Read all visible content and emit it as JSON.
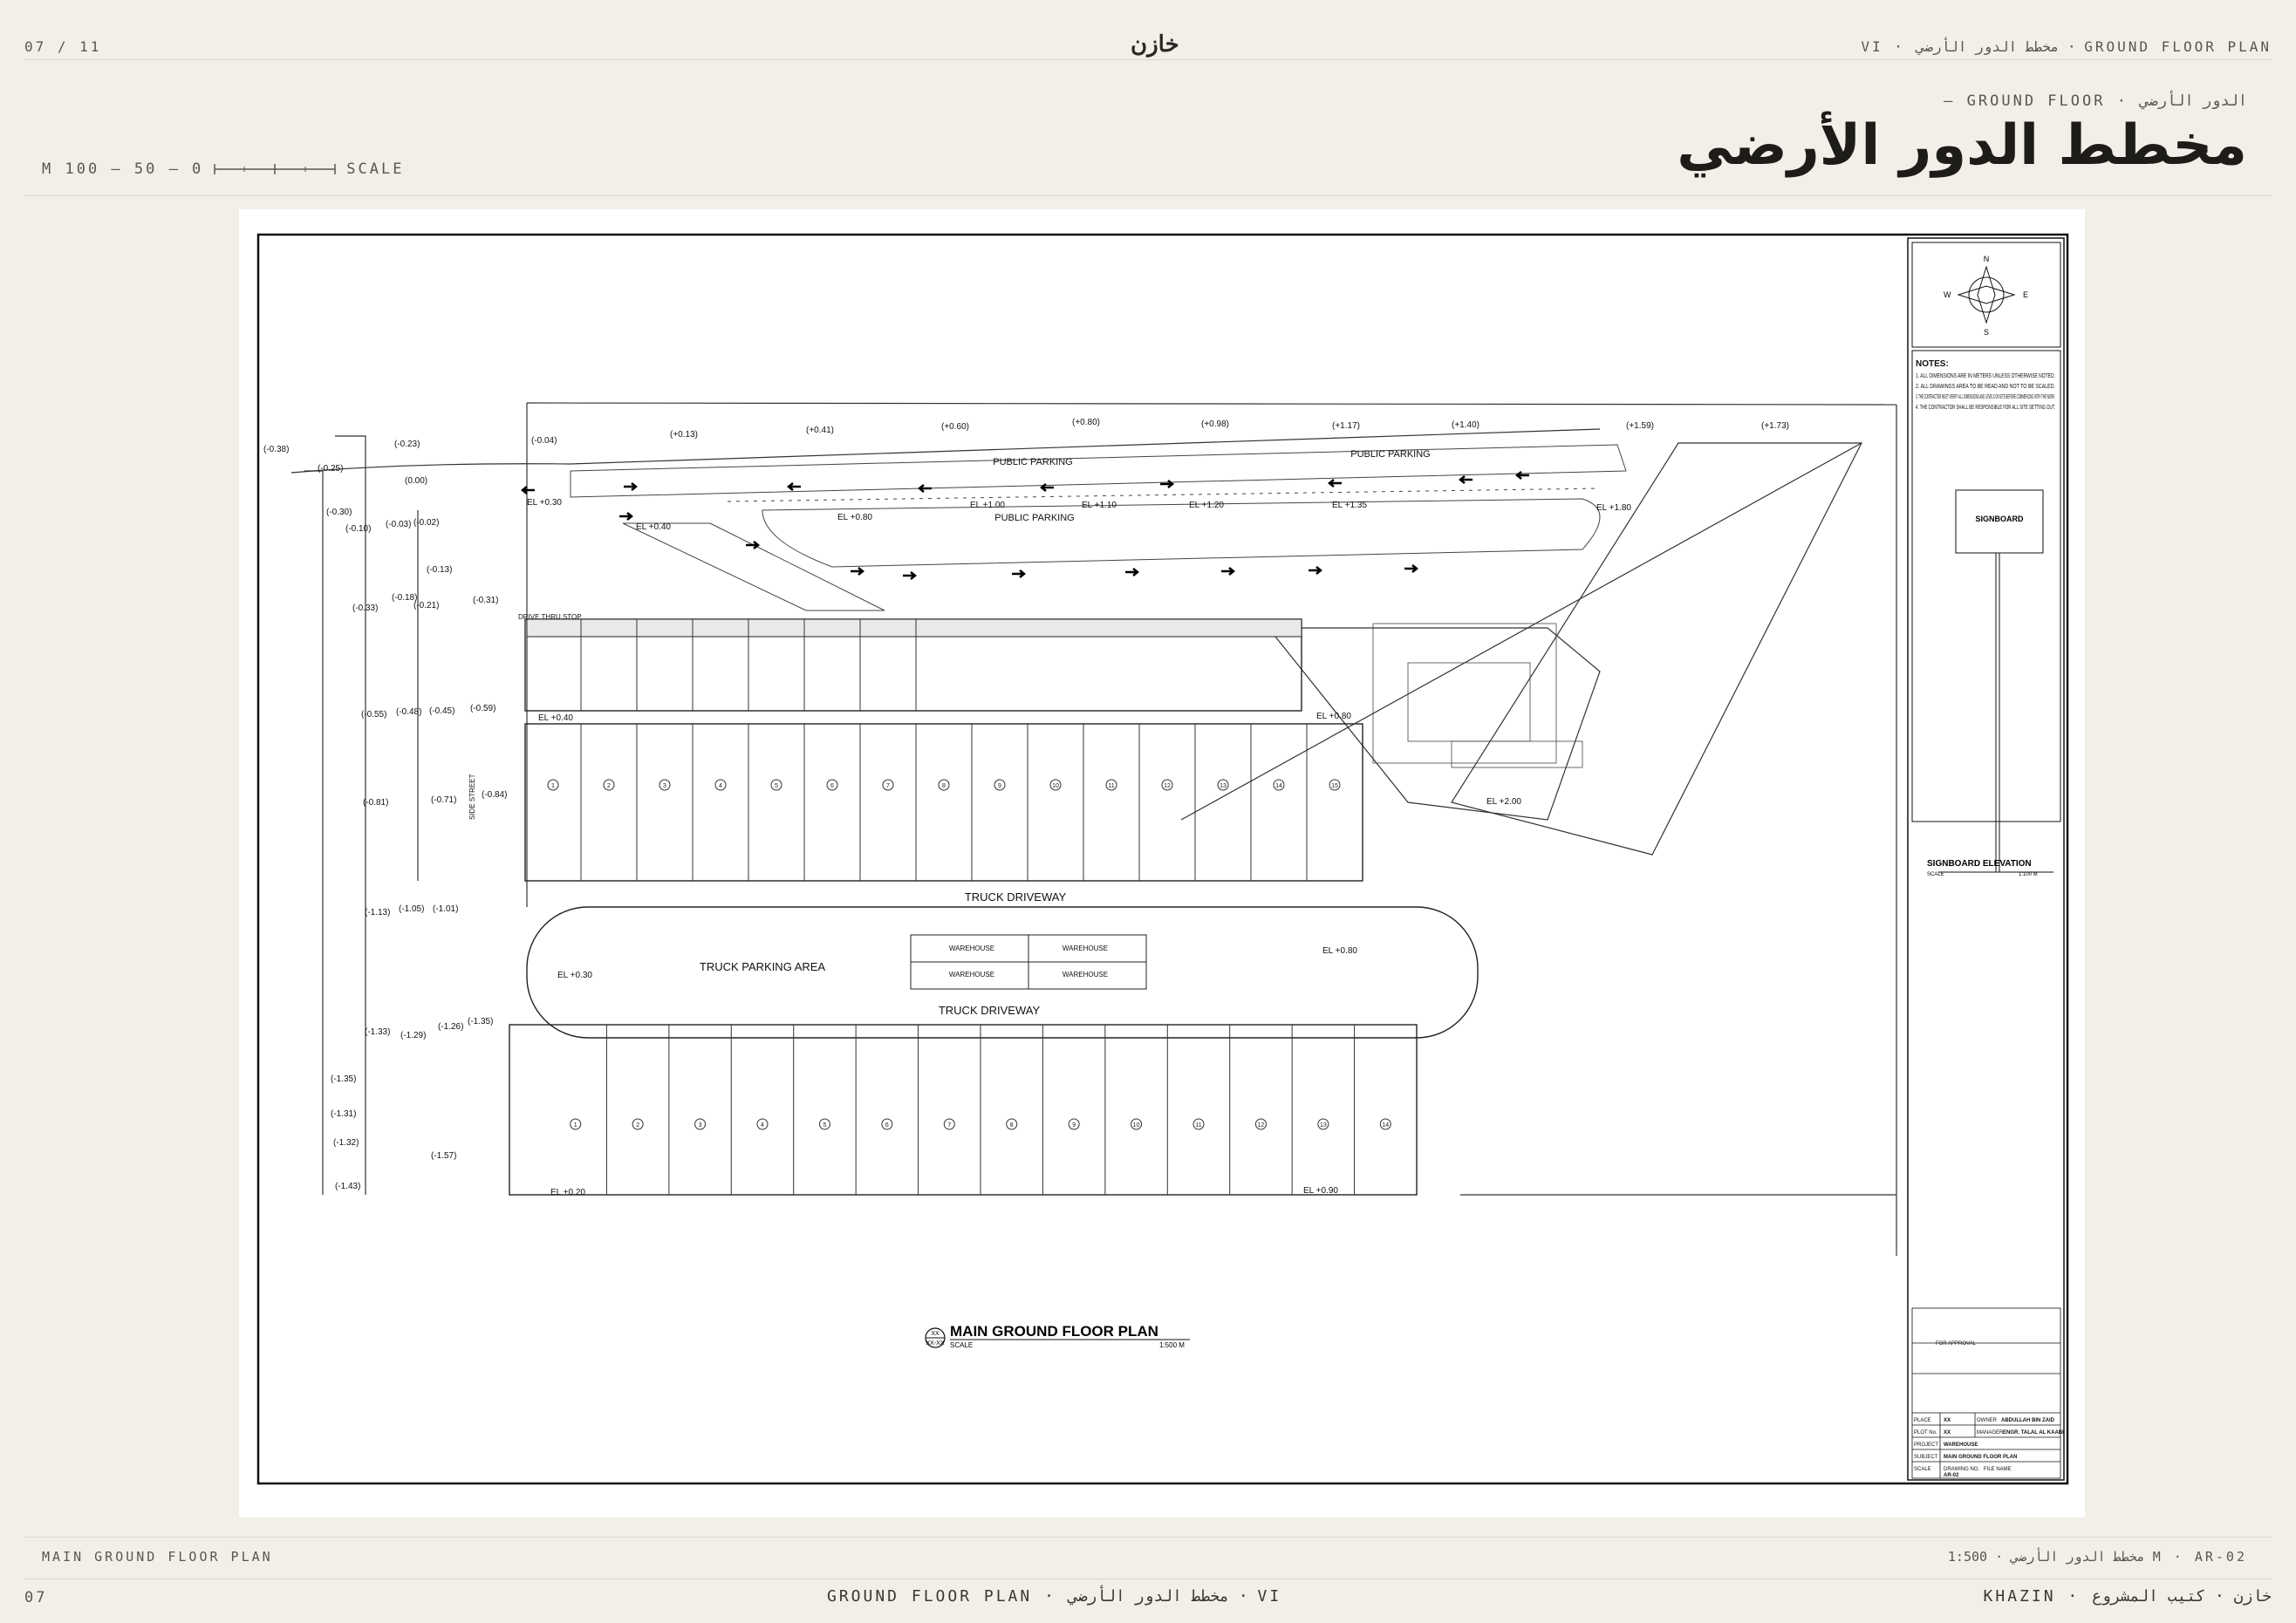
{
  "header": {
    "page_counter": "07 / 11",
    "logo_text": "خازن",
    "right_label": "VI · مخطط الدور الأرضي · GROUND FLOOR PLAN"
  },
  "title_block": {
    "eyebrow": "— GROUND FLOOR · الدور الأرضي",
    "title": "مخطط الدور الأرضي",
    "scale_label_left": "M 100 — 50 — 0",
    "scale_label_right": "SCALE"
  },
  "drawing": {
    "plan_title": "MAIN GROUND FLOOR PLAN",
    "plan_scale_label": "SCALE",
    "plan_scale_value": "1:500 M",
    "tag_top": "XX",
    "tag_bottom": "XX-XX",
    "labels": {
      "public_parking_1": "PUBLIC PARKING",
      "public_parking_2": "PUBLIC PARKING",
      "public_parking_3": "PUBLIC PARKING",
      "truck_driveway_1": "TRUCK DRIVEWAY",
      "truck_driveway_2": "TRUCK DRIVEWAY",
      "truck_parking": "TRUCK PARKING AREA",
      "drive_thru": "DRIVE THRU STOP",
      "side_street": "SIDE STREET",
      "warehouse": "WAREHOUSE"
    },
    "levels_top": [
      "(-0.38)",
      "(-0.23)",
      "(-0.04)",
      "(+0.13)",
      "(+0.41)",
      "(+0.60)",
      "(+0.80)",
      "(+0.98)",
      "(+1.17)",
      "(+1.40)",
      "(+1.59)",
      "(+1.73)"
    ],
    "levels_left": [
      "(-0.25)",
      "(0.00)",
      "(-0.30)",
      "(-0.10)",
      "(-0.03)",
      "(-0.02)",
      "(-0.13)",
      "(-0.18)",
      "(-0.33)",
      "(-0.21)",
      "(-0.31)",
      "(-0.55)",
      "(-0.48)",
      "(-0.45)",
      "(-0.59)",
      "(-0.81)",
      "(-0.71)",
      "(-0.84)",
      "(-1.13)",
      "(-1.05)",
      "(-1.01)",
      "(-1.33)",
      "(-1.29)",
      "(-1.26)",
      "(-1.35)",
      "(-1.35)",
      "(-1.31)",
      "(-1.32)",
      "(-1.57)",
      "(-1.43)"
    ],
    "elevations": [
      "EL +0.30",
      "EL +0.40",
      "EL +0.80",
      "EL +1.00",
      "EL +1.10",
      "EL +1.20",
      "EL +1.35",
      "EL +1.80",
      "EL +0.40",
      "EL +0.80",
      "EL +2.00",
      "EL +0.30",
      "EL +0.80",
      "EL +0.20",
      "EL +0.90"
    ],
    "units_row1": [
      "1",
      "2",
      "3",
      "4",
      "5",
      "6",
      "7",
      "8",
      "9",
      "10",
      "11",
      "12",
      "13",
      "14",
      "15"
    ],
    "units_row2": [
      "1",
      "2",
      "3",
      "4",
      "5",
      "6",
      "7",
      "8",
      "9",
      "10",
      "11",
      "12",
      "13",
      "14"
    ]
  },
  "sidebar": {
    "compass": {
      "n": "N",
      "s": "S",
      "e": "E",
      "w": "W"
    },
    "notes_title": "NOTES:",
    "notes": [
      "1. ALL DIMENSIONS ARE IN METERS UNLESS OTHERWISE NOTED.",
      "2. ALL DRAWINGS AREA TO BE READ AND NOT TO BE SCALED.",
      "3. THE CONTRACTOR MUST VERIFY ALL DIMENSIONS AND LEVELS ON SITE BEFORE COMMENCING WITH THE WORK.",
      "4. THE CONTRACTOR SHALL BE RESPONSIBLE FOR ALL SITE SETTING OUT."
    ],
    "signboard": "SIGNBOARD",
    "signboard_elevation": "SIGNBOARD ELEVATION",
    "signboard_scale_label": "SCALE",
    "signboard_scale_value": "1:100 M",
    "title_block": {
      "for_approval": "FOR APPROVAL",
      "place_label": "PLACE",
      "place_value": "XX",
      "owner_label": "OWNER",
      "owner_value": "ABDULLAH BIN ZAID",
      "plot_label": "PLOT No.",
      "plot_value": "XX",
      "manager_label": "MANAGER",
      "manager_value": "ENGR. TALAL AL KAABI",
      "project_label": "PROJECT",
      "project_value": "WAREHOUSE",
      "subject_label": "SUBJECT",
      "subject_value": "MAIN GROUND FLOOR PLAN",
      "scale_label": "SCALE",
      "drawing_no_label": "DRAWING NO.",
      "drawing_no_value": "AR-02",
      "file_name_label": "FILE NAME"
    }
  },
  "bottom_caption": {
    "left": "MAIN GROUND FLOOR PLAN",
    "right": "مخطط الدور الأرضي · 1:500 M · AR-02"
  },
  "footer": {
    "page_number": "07",
    "center": "GROUND FLOOR PLAN · مخطط الدور الأرضي · VI",
    "right": "KHAZIN · خازن · كتيب المشروع"
  }
}
